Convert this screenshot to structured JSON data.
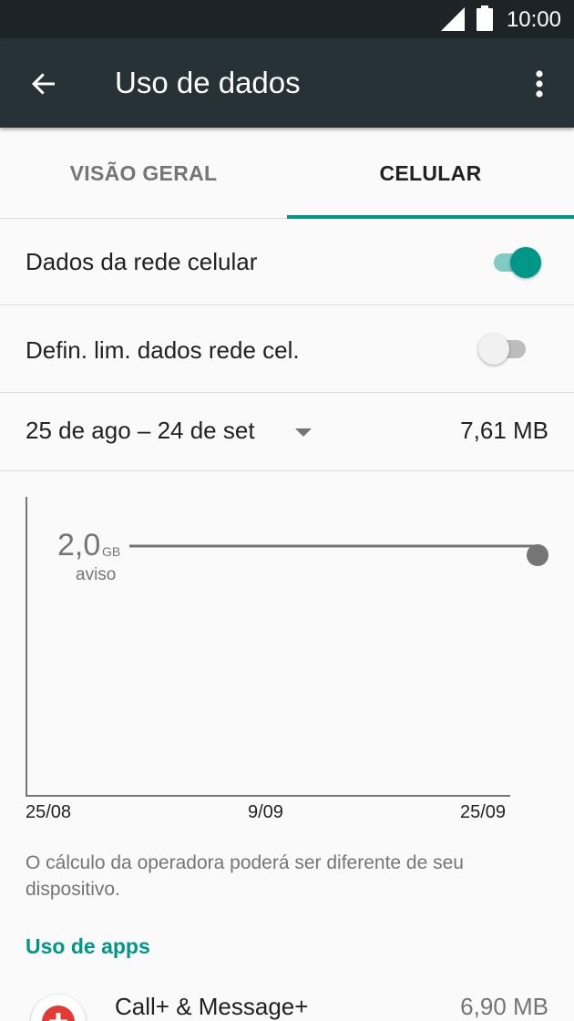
{
  "status_bar": {
    "time": "10:00",
    "icons": [
      "signal-icon",
      "battery-icon"
    ]
  },
  "app_bar": {
    "title": "Uso de dados",
    "back_icon": "arrow-back-icon",
    "menu_icon": "more-vert-icon"
  },
  "tabs": [
    {
      "label": "VISÃO GERAL",
      "selected": false
    },
    {
      "label": "CELULAR",
      "selected": true
    }
  ],
  "settings": {
    "mobile_data": {
      "label": "Dados da rede celular",
      "enabled": true
    },
    "data_limit": {
      "label": "Defin. lim. dados rede cel.",
      "enabled": false
    }
  },
  "cycle": {
    "range": "25 de ago – 24 de set",
    "usage": "7,61 MB"
  },
  "chart": {
    "warning_value": "2,0",
    "warning_unit": "GB",
    "warning_label": "aviso",
    "x_ticks": [
      "25/08",
      "9/09",
      "25/09"
    ]
  },
  "note": "O cálculo da operadora poderá ser diferente de seu dispositivo.",
  "app_usage": {
    "header": "Uso de apps",
    "apps": [
      {
        "name": "Call+ & Message+",
        "usage": "6,90 MB"
      }
    ]
  },
  "colors": {
    "accent": "#009688",
    "app_bar": "#263238",
    "status_bar": "#1e2327"
  }
}
